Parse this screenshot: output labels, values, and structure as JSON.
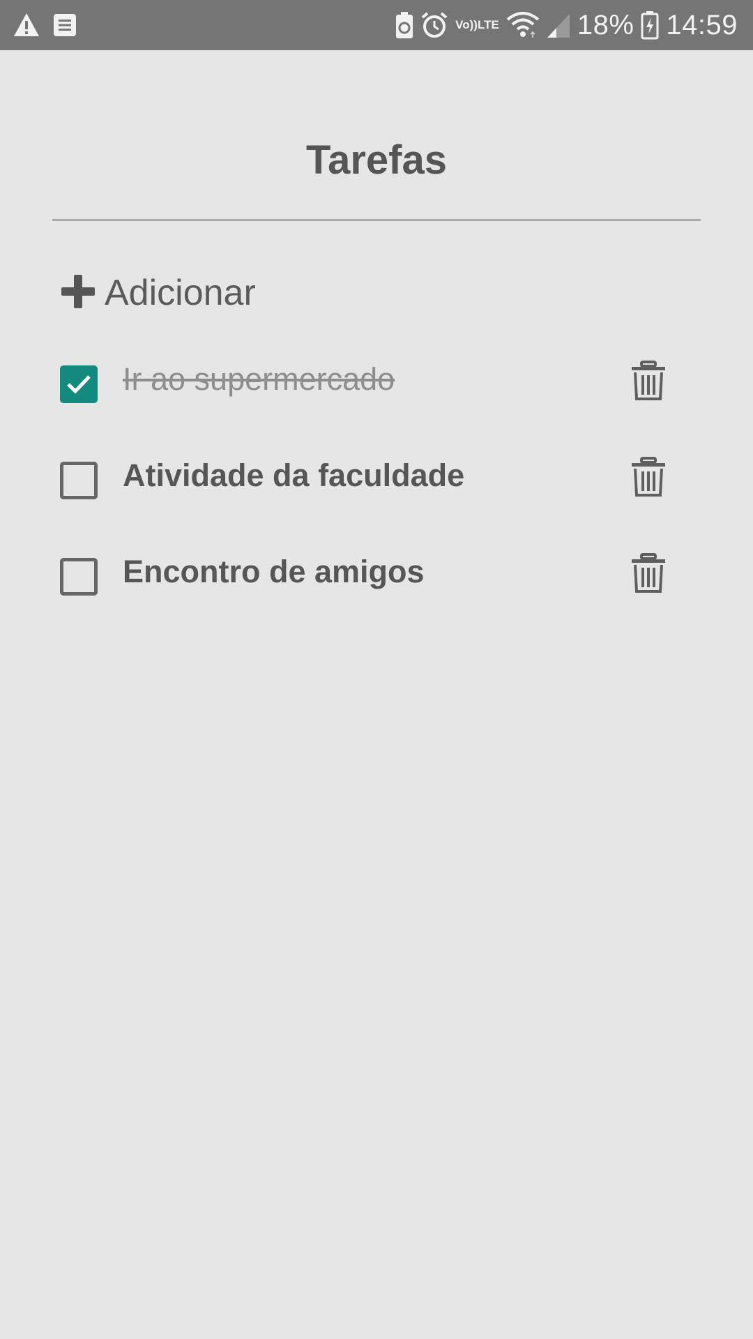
{
  "status_bar": {
    "icons_left": [
      "warning-icon",
      "notes-icon"
    ],
    "icons_right": [
      "battery-saver-icon",
      "alarm-icon",
      "volte-icon",
      "wifi-icon",
      "signal-icon",
      "battery-icon"
    ],
    "volte_top": "Vo))",
    "volte_bottom": "LTE",
    "battery_percent": "18%",
    "time": "14:59",
    "background": "#757575"
  },
  "page": {
    "title": "Tarefas",
    "add_label": "Adicionar",
    "add_icon": "plus-icon"
  },
  "tasks": [
    {
      "label": "Ir ao supermercado",
      "done": true,
      "delete_icon": "trash-icon"
    },
    {
      "label": "Atividade da faculdade",
      "done": false,
      "delete_icon": "trash-icon"
    },
    {
      "label": "Encontro de amigos",
      "done": false,
      "delete_icon": "trash-icon"
    }
  ],
  "colors": {
    "background": "#e6e6e7",
    "accent_checked": "#128a7e",
    "text": "#555555",
    "done_text": "#8e8e8e"
  }
}
